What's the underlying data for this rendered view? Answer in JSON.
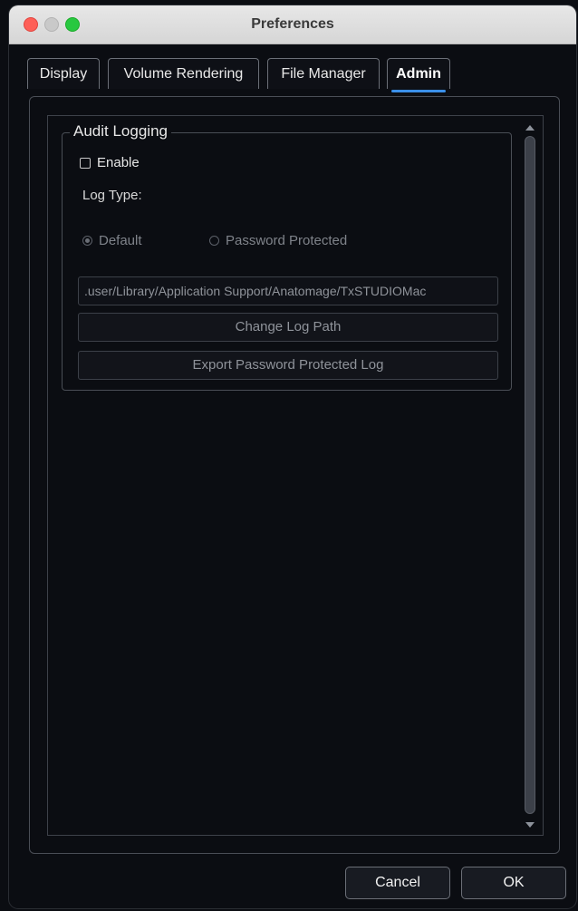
{
  "window": {
    "title": "Preferences"
  },
  "tabs": [
    {
      "label": "Display"
    },
    {
      "label": "Volume Rendering"
    },
    {
      "label": "File Manager"
    },
    {
      "label": "Admin",
      "active": true
    }
  ],
  "audit": {
    "group_title": "Audit Logging",
    "enable_label": "Enable",
    "enable_checked": false,
    "log_type_label": "Log Type:",
    "radio_default_label": "Default",
    "radio_password_label": "Password Protected",
    "selected_log_type": "Default",
    "path_value": ".user/Library/Application Support/Anatomage/TxSTUDIOMac",
    "change_path_label": "Change Log Path",
    "export_label": "Export Password Protected Log"
  },
  "footer": {
    "cancel_label": "Cancel",
    "ok_label": "OK"
  },
  "colors": {
    "background": "#0b0d12",
    "accent": "#3a8fe8",
    "close": "#fe5f57",
    "maximize": "#28c840"
  }
}
